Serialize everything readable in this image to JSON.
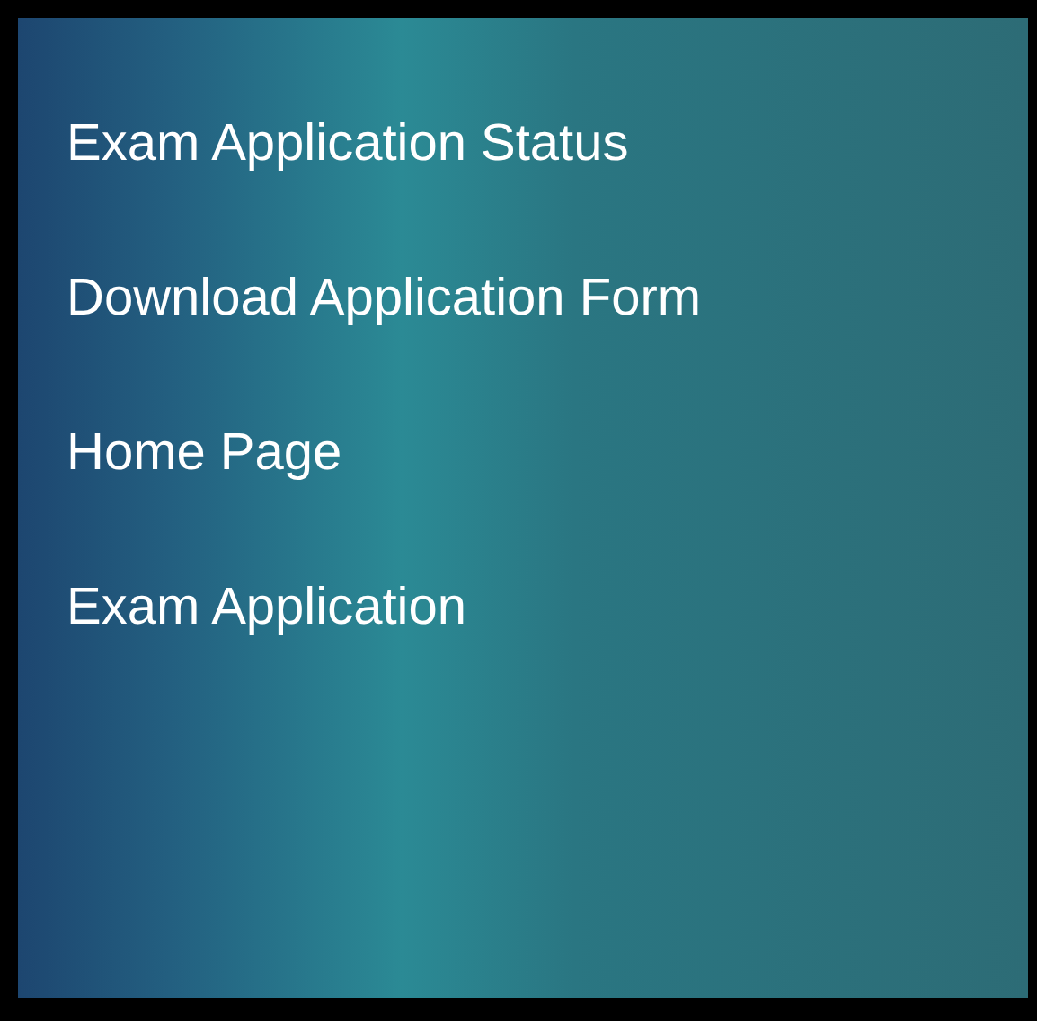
{
  "menu": {
    "items": [
      {
        "label": "Exam Application Status"
      },
      {
        "label": "Download Application Form"
      },
      {
        "label": "Home Page"
      },
      {
        "label": "Exam Application"
      }
    ]
  }
}
